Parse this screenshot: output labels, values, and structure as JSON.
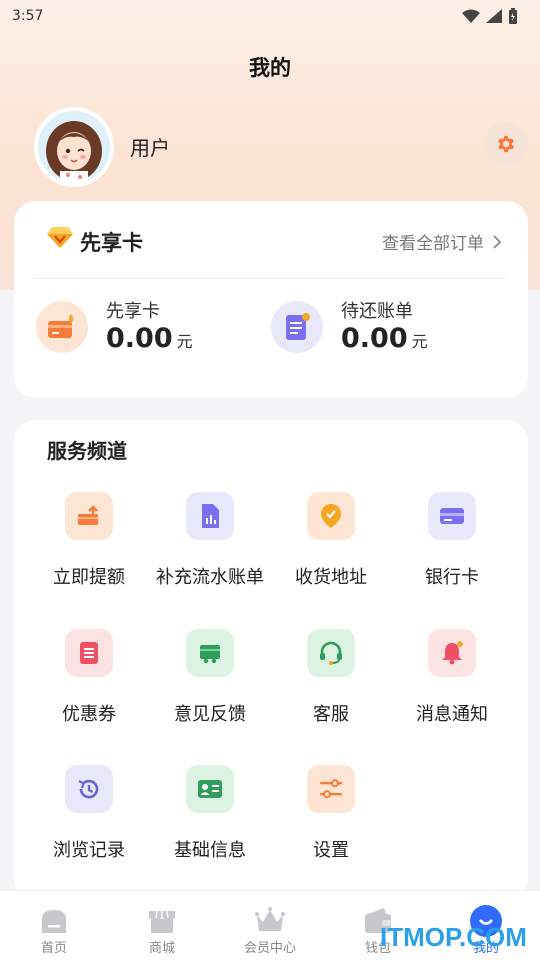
{
  "status_bar": {
    "time": "3:57"
  },
  "header": {
    "title": "我的"
  },
  "profile": {
    "username": "用户"
  },
  "vip_card": {
    "title": "先享卡",
    "view_all_label": "查看全部订单",
    "stats": [
      {
        "label": "先享卡",
        "value": "0.00",
        "unit": "元"
      },
      {
        "label": "待还账单",
        "value": "0.00",
        "unit": "元"
      }
    ]
  },
  "services": {
    "title": "服务频道",
    "items": [
      {
        "label": "立即提额",
        "icon": "raise-limit-icon"
      },
      {
        "label": "补充流水账单",
        "icon": "statement-icon"
      },
      {
        "label": "收货地址",
        "icon": "location-icon"
      },
      {
        "label": "银行卡",
        "icon": "bank-card-icon"
      },
      {
        "label": "优惠券",
        "icon": "coupon-icon"
      },
      {
        "label": "意见反馈",
        "icon": "feedback-icon"
      },
      {
        "label": "客服",
        "icon": "headset-icon"
      },
      {
        "label": "消息通知",
        "icon": "bell-icon"
      },
      {
        "label": "浏览记录",
        "icon": "history-icon"
      },
      {
        "label": "基础信息",
        "icon": "id-card-icon"
      },
      {
        "label": "设置",
        "icon": "sliders-icon"
      }
    ]
  },
  "tabbar": {
    "items": [
      {
        "label": "首页",
        "icon": "home-icon"
      },
      {
        "label": "商城",
        "icon": "store-icon"
      },
      {
        "label": "会员中心",
        "icon": "crown-icon"
      },
      {
        "label": "钱包",
        "icon": "wallet-icon"
      },
      {
        "label": "我的",
        "icon": "profile-icon",
        "active": true
      }
    ]
  },
  "watermark": "ITMOP.COM",
  "colors": {
    "accent": "#2f6bff",
    "orange": "#f47b3a",
    "brand_bg": "#fce3d3"
  }
}
